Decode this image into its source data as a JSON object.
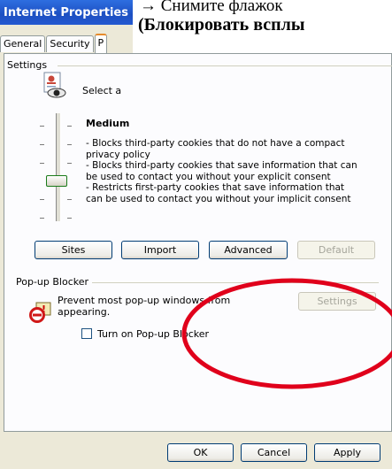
{
  "window": {
    "title": "Internet Properties"
  },
  "caption": {
    "line1": "→ Снимите флажок",
    "line2": "(Блокировать всплы"
  },
  "tabs": [
    {
      "label": "General"
    },
    {
      "label": "Security"
    },
    {
      "label": "P"
    }
  ],
  "settings": {
    "group_label": "Settings",
    "select_text": "Select a",
    "level": "Medium",
    "description": [
      "- Blocks third-party cookies that do not have a compact",
      "privacy policy",
      "- Blocks third-party cookies that save information that can",
      "be used to contact you without your explicit consent",
      "- Restricts first-party cookies that save information that",
      "can be used to contact you without your implicit consent"
    ]
  },
  "buttons": {
    "sites": "Sites",
    "import": "Import",
    "advanced": "Advanced",
    "default": "Default"
  },
  "popup_blocker": {
    "group_label": "Pop-up Blocker",
    "text": "Prevent most pop-up windows from appearing.",
    "settings_button": "Settings",
    "checkbox_label": "Turn on Pop-up Blocker",
    "checkbox_checked": false
  },
  "footer": {
    "ok": "OK",
    "cancel": "Cancel",
    "apply": "Apply"
  },
  "colors": {
    "title_bar": "#1c4fc2",
    "dialog_bg": "#ece9d8",
    "annotation": "#e0001b"
  }
}
